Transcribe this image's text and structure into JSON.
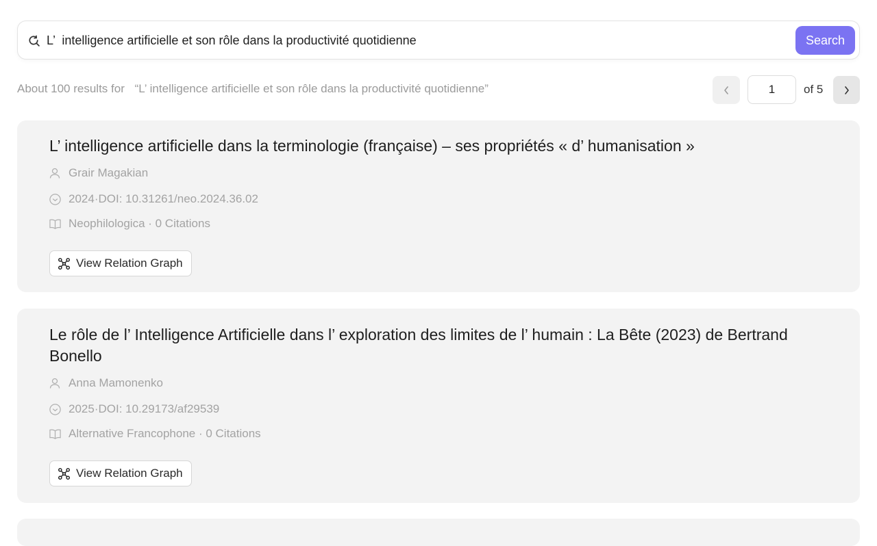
{
  "search": {
    "query": "L’  intelligence artificielle et son rôle dans la productivité quotidienne",
    "button_label": "Search",
    "icon": "search-refresh-icon"
  },
  "results_meta": {
    "prefix": "About 100 results for",
    "query_quoted": "“L’  intelligence artificielle et son rôle dans la productivité quotidienne”"
  },
  "pagination": {
    "current_page": "1",
    "total_label": "of 5",
    "prev_icon": "chevron-left-icon",
    "next_icon": "chevron-right-icon"
  },
  "results": [
    {
      "title": "L’  intelligence artificielle dans la terminologie (française) – ses propriétés « d’  humanisation »",
      "author": "Grair Magakian",
      "date_doi": "2024·DOI: 10.31261/neo.2024.36.02",
      "venue_citations": "Neophilologica · 0 Citations",
      "graph_button": "View Relation Graph"
    },
    {
      "title": "Le rôle de l’  Intelligence Artificielle dans l’  exploration des limites de l’  humain : La Bête (2023) de Bertrand Bonello",
      "author": "Anna Mamonenko",
      "date_doi": "2025·DOI: 10.29173/af29539",
      "venue_citations": "Alternative Francophone · 0 Citations",
      "graph_button": "View Relation Graph"
    }
  ],
  "colors": {
    "accent": "#7b73f2",
    "card_bg": "#f3f3f3",
    "muted_text": "#a3a3a3"
  }
}
